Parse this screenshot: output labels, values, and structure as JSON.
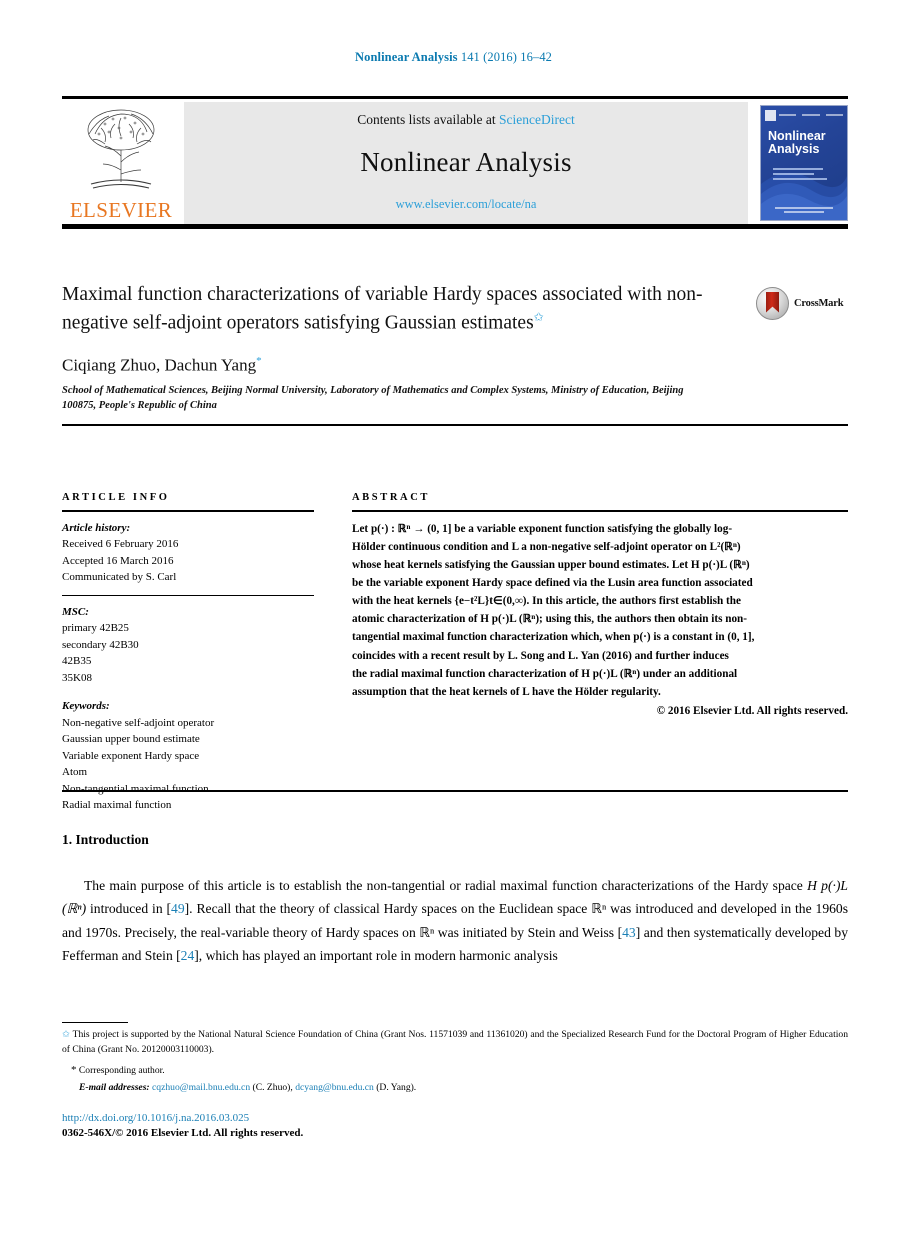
{
  "running_head": {
    "journal": "Nonlinear Analysis",
    "reference": "141 (2016) 16–42"
  },
  "masthead": {
    "publisher": "ELSEVIER",
    "contents_prefix": "Contents lists available at ",
    "contents_link": "ScienceDirect",
    "journal_title": "Nonlinear Analysis",
    "journal_url": "www.elsevier.com/locate/na",
    "cover_title_line1": "Nonlinear",
    "cover_title_line2": "Analysis"
  },
  "article": {
    "title": "Maximal function characterizations of variable Hardy spaces associated with non-negative self-adjoint operators satisfying Gaussian estimates",
    "title_footnote_marker": "✩",
    "crossmark_label": "CrossMark",
    "authors": "Ciqiang Zhuo, Dachun Yang",
    "corresponding_marker": "*",
    "affiliation": "School of Mathematical Sciences, Beijing Normal University, Laboratory of Mathematics and Complex Systems, Ministry of Education, Beijing 100875, People's Republic of China"
  },
  "article_info": {
    "heading": "ARTICLE INFO",
    "history_label": "Article history:",
    "history": [
      "Received 6 February 2016",
      "Accepted 16 March 2016",
      "Communicated by S. Carl"
    ],
    "msc_label": "MSC:",
    "msc": [
      "primary 42B25",
      "secondary 42B30",
      "42B35",
      "35K08"
    ],
    "keywords_label": "Keywords:",
    "keywords": [
      "Non-negative self-adjoint operator",
      "Gaussian upper bound estimate",
      "Variable exponent Hardy space",
      "Atom",
      "Non-tangential maximal function",
      "Radial maximal function"
    ]
  },
  "abstract": {
    "heading": "ABSTRACT",
    "lines": [
      "Let p(·) : ℝⁿ → (0, 1] be a variable exponent function satisfying the globally log-",
      "Hölder continuous condition and L a non-negative self-adjoint operator on L²(ℝⁿ)",
      "whose heat kernels satisfying the Gaussian upper bound estimates. Let H p(·)L (ℝⁿ)",
      "be the variable exponent Hardy space defined via the Lusin area function associated",
      "with the heat kernels {e−t²L}t∈(0,∞). In this article, the authors first establish the",
      "atomic characterization of H p(·)L (ℝⁿ); using this, the authors then obtain its non-",
      "tangential maximal function characterization which, when p(·) is a constant in (0, 1],",
      "coincides with a recent result by L. Song and L. Yan (2016) and further induces",
      "the radial maximal function characterization of H p(·)L (ℝⁿ) under an additional",
      "assumption that the heat kernels of L have the Hölder regularity."
    ],
    "copyright": "© 2016 Elsevier Ltd. All rights reserved."
  },
  "introduction": {
    "heading": "1. Introduction",
    "paragraph_parts": [
      "The main purpose of this article is to establish the non-tangential or radial maximal function characterizations of the Hardy space ",
      "H p(·)L (ℝⁿ)",
      " introduced in [",
      "49",
      "]. Recall that the theory of classical Hardy spaces on the Euclidean space ℝⁿ was introduced and developed in the 1960s and 1970s. Precisely, the real-variable theory of Hardy spaces on ℝⁿ was initiated by Stein and Weiss [",
      "43",
      "] and then systematically developed by Fefferman and Stein [",
      "24",
      "], which has played an important role in modern harmonic analysis"
    ],
    "citations": [
      "49",
      "43",
      "24"
    ]
  },
  "footnotes": {
    "funding_marker": "✩",
    "funding": "This project is supported by the National Natural Science Foundation of China (Grant Nos. 11571039 and 11361020) and the Specialized Research Fund for the Doctoral Program of Higher Education of China (Grant No. 20120003110003).",
    "corresponding_marker": "*",
    "corresponding": "Corresponding author.",
    "email_label": "E-mail addresses:",
    "email_1": "cqzhuo@mail.bnu.edu.cn",
    "email_1_owner": "(C. Zhuo),",
    "email_2": "dcyang@bnu.edu.cn",
    "email_2_owner": "(D. Yang)."
  },
  "footer": {
    "doi": "http://dx.doi.org/10.1016/j.na.2016.03.025",
    "issn_line": "0362-546X/© 2016 Elsevier Ltd. All rights reserved."
  },
  "colors": {
    "link_blue": "#1a7fb5",
    "accent_blue": "#2b9fd8",
    "elsevier_orange": "#E87722",
    "cover_blue": "#244497",
    "crossmark_red": "#cf2a18"
  }
}
